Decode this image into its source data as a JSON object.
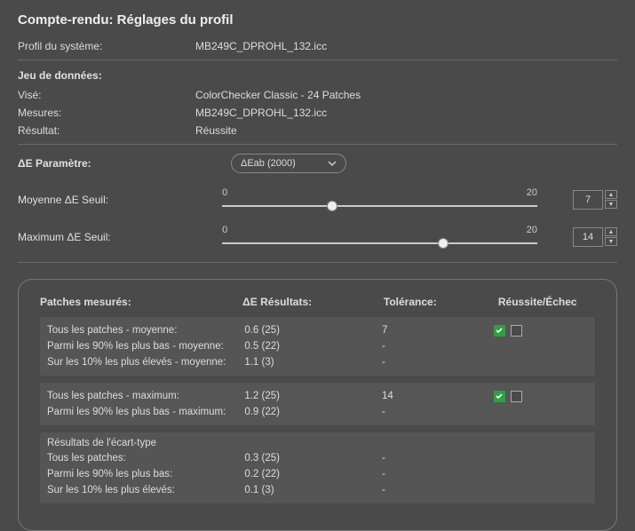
{
  "title": "Compte-rendu: Réglages du profil",
  "systemProfile": {
    "label": "Profil du système:",
    "value": "MB249C_DPROHL_132.icc"
  },
  "dataset": {
    "header": "Jeu de données:",
    "target": {
      "label": "Visé:",
      "value": "ColorChecker Classic - 24 Patches"
    },
    "measures": {
      "label": "Mesures:",
      "value": "MB249C_DPROHL_132.icc"
    },
    "result": {
      "label": "Résultat:",
      "value": "Réussite"
    }
  },
  "deParam": {
    "label": "ΔE Paramètre:",
    "selected": "ΔEab (2000)"
  },
  "sliderRange": {
    "min": "0",
    "max": "20"
  },
  "avgThreshold": {
    "label": "Moyenne ΔE Seuil:",
    "value": "7"
  },
  "maxThreshold": {
    "label": "Maximum ΔE Seuil:",
    "value": "14"
  },
  "table": {
    "headers": {
      "patches": "Patches mesurés:",
      "results": "ΔE Résultats:",
      "tolerance": "Tolérance:",
      "passfail": "Réussite/Échec"
    },
    "group1": {
      "r0": {
        "label": "Tous les patches - moyenne:",
        "result": "0.6 (25)",
        "tol": "7"
      },
      "r1": {
        "label": "Parmi les 90% les plus bas - moyenne:",
        "result": "0.5 (22)",
        "tol": "-"
      },
      "r2": {
        "label": "Sur les 10% les plus élevés - moyenne:",
        "result": "1.1 (3)",
        "tol": "-"
      }
    },
    "group2": {
      "r0": {
        "label": "Tous les patches - maximum:",
        "result": "1.2 (25)",
        "tol": "14"
      },
      "r1": {
        "label": "Parmi les 90% les plus bas - maximum:",
        "result": "0.9 (22)",
        "tol": "-"
      }
    },
    "group3": {
      "header": "Résultats de l'écart-type",
      "r0": {
        "label": "Tous les patches:",
        "result": "0.3 (25)",
        "tol": "-"
      },
      "r1": {
        "label": "Parmi les 90% les plus bas:",
        "result": "0.2 (22)",
        "tol": "-"
      },
      "r2": {
        "label": "Sur les 10% les plus élevés:",
        "result": "0.1 (3)",
        "tol": "-"
      }
    }
  }
}
